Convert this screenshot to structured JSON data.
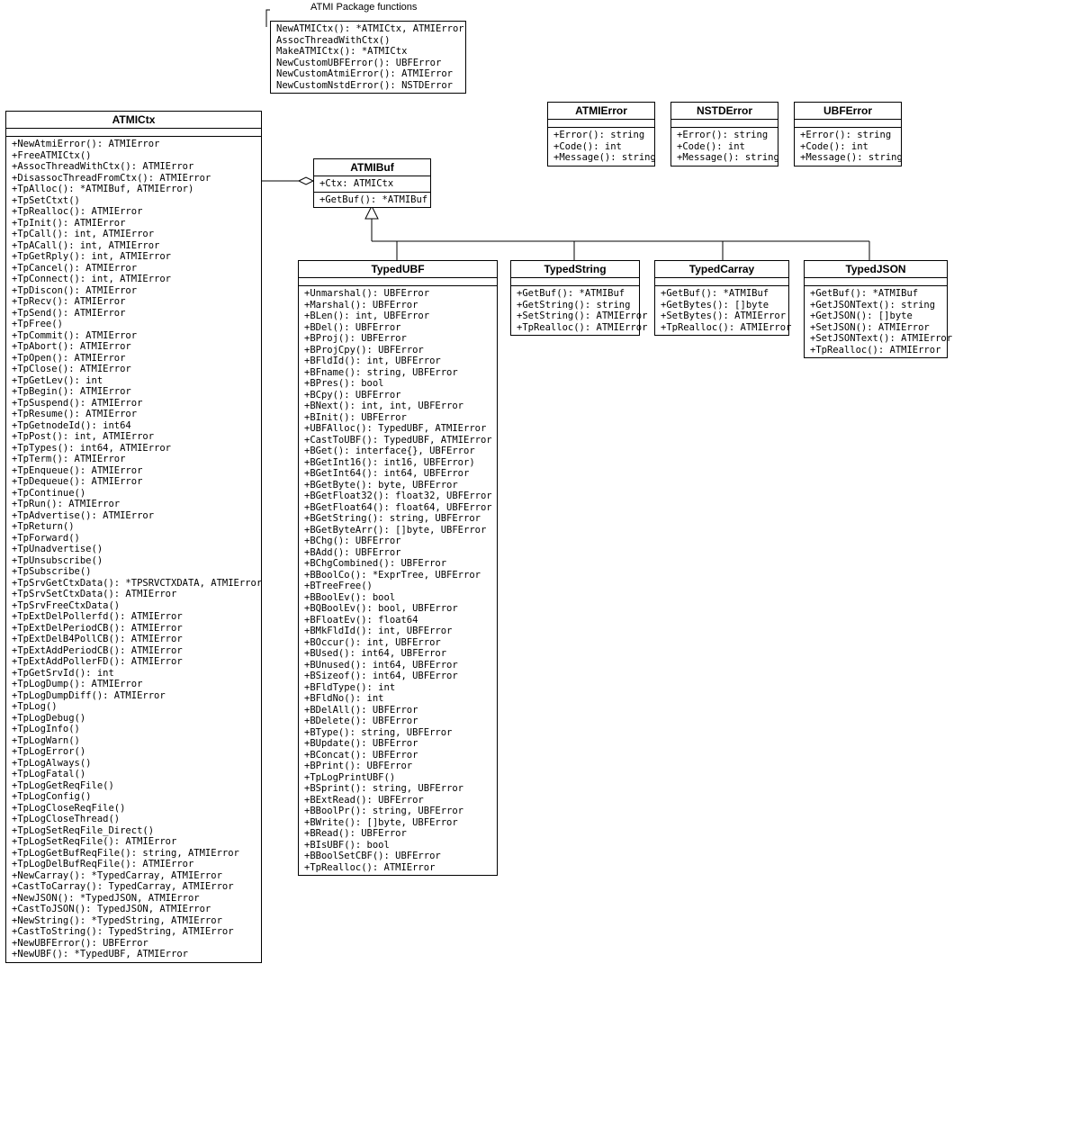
{
  "package_label": "ATMI Package functions",
  "package_box": {
    "methods": [
      "NewATMICtx(): *ATMICtx, ATMIError",
      "AssocThreadWithCtx()",
      "MakeATMICtx(): *ATMICtx",
      "NewCustomUBFError(): UBFError",
      "NewCustomAtmiError(): ATMIError",
      "NewCustomNstdError(): NSTDError"
    ]
  },
  "atmictx": {
    "title": "ATMICtx",
    "methods": [
      "+NewAtmiError(): ATMIError",
      "+FreeATMICtx()",
      "+AssocThreadWithCtx(): ATMIError",
      "+DisassocThreadFromCtx(): ATMIError",
      "+TpAlloc(): *ATMIBuf, ATMIError)",
      "+TpSetCtxt()",
      "+TpRealloc(): ATMIError",
      "+TpInit(): ATMIError",
      "+TpCall(): int, ATMIError",
      "+TpACall(): int, ATMIError",
      "+TpGetRply(): int, ATMIError",
      "+TpCancel(): ATMIError",
      "+TpConnect(): int, ATMIError",
      "+TpDiscon(): ATMIError",
      "+TpRecv(): ATMIError",
      "+TpSend(): ATMIError",
      "+TpFree()",
      "+TpCommit(): ATMIError",
      "+TpAbort(): ATMIError",
      "+TpOpen(): ATMIError",
      "+TpClose(): ATMIError",
      "+TpGetLev(): int",
      "+TpBegin(): ATMIError",
      "+TpSuspend(): ATMIError",
      "+TpResume(): ATMIError",
      "+TpGetnodeId(): int64",
      "+TpPost(): int, ATMIError",
      "+TpTypes(): int64, ATMIError",
      "+TpTerm(): ATMIError",
      "+TpEnqueue(): ATMIError",
      "+TpDequeue(): ATMIError",
      "+TpContinue()",
      "+TpRun(): ATMIError",
      "+TpAdvertise(): ATMIError",
      "+TpReturn()",
      "+TpForward()",
      "+TpUnadvertise()",
      "+TpUnsubscribe()",
      "+TpSubscribe()",
      "+TpSrvGetCtxData(): *TPSRVCTXDATA, ATMIError",
      "+TpSrvSetCtxData(): ATMIError",
      "+TpSrvFreeCtxData()",
      "+TpExtDelPollerfd(): ATMIError",
      "+TpExtDelPeriodCB(): ATMIError",
      "+TpExtDelB4PollCB(): ATMIError",
      "+TpExtAddPeriodCB(): ATMIError",
      "+TpExtAddPollerFD(): ATMIError",
      "+TpGetSrvId(): int",
      "+TpLogDump(): ATMIError",
      "+TpLogDumpDiff(): ATMIError",
      "+TpLog()",
      "+TpLogDebug()",
      "+TpLogInfo()",
      "+TpLogWarn()",
      "+TpLogError()",
      "+TpLogAlways()",
      "+TpLogFatal()",
      "+TpLogGetReqFile()",
      "+TpLogConfig()",
      "+TpLogCloseReqFile()",
      "+TpLogCloseThread()",
      "+TpLogSetReqFile_Direct()",
      "+TpLogSetReqFile(): ATMIError",
      "+TpLogGetBufReqFile(): string, ATMIError",
      "+TpLogDelBufReqFile(): ATMIError",
      "+NewCarray(): *TypedCarray, ATMIError",
      "+CastToCarray(): TypedCarray, ATMIError",
      "+NewJSON(): *TypedJSON, ATMIError",
      "+CastToJSON(): TypedJSON, ATMIError",
      "+NewString(): *TypedString, ATMIError",
      "+CastToString(): TypedString, ATMIError",
      "+NewUBFError(): UBFError",
      "+NewUBF(): *TypedUBF, ATMIError"
    ]
  },
  "atmibuf": {
    "title": "ATMIBuf",
    "members": [
      "+Ctx: ATMICtx",
      "+GetBuf(): *ATMIBuf"
    ]
  },
  "atmierror": {
    "title": "ATMIError",
    "methods": [
      "+Error(): string",
      "+Code(): int",
      "+Message(): string"
    ]
  },
  "nstderror": {
    "title": "NSTDError",
    "methods": [
      "+Error(): string",
      "+Code(): int",
      "+Message(): string"
    ]
  },
  "ubferror": {
    "title": "UBFError",
    "methods": [
      "+Error(): string",
      "+Code(): int",
      "+Message(): string"
    ]
  },
  "typedubf": {
    "title": "TypedUBF",
    "methods": [
      "+Unmarshal(): UBFError",
      "+Marshal(): UBFError",
      "+BLen(): int, UBFError",
      "+BDel(): UBFError",
      "+BProj(): UBFError",
      "+BProjCpy(): UBFError",
      "+BFldId(): int, UBFError",
      "+BFname(): string, UBFError",
      "+BPres(): bool",
      "+BCpy(): UBFError",
      "+BNext(): int, int, UBFError",
      "+BInit(): UBFError",
      "+UBFAlloc(): TypedUBF, ATMIError",
      "+CastToUBF(): TypedUBF, ATMIError",
      "+BGet(): interface{}, UBFError",
      "+BGetInt16(): int16, UBFError)",
      "+BGetInt64(): int64, UBFError",
      "+BGetByte(): byte, UBFError",
      "+BGetFloat32(): float32, UBFError",
      "+BGetFloat64(): float64, UBFError",
      "+BGetString(): string, UBFError",
      "+BGetByteArr(): []byte, UBFError",
      "+BChg(): UBFError",
      "+BAdd(): UBFError",
      "+BChgCombined(): UBFError",
      "+BBoolCo(): *ExprTree, UBFError",
      "+BTreeFree()",
      "+BBoolEv(): bool",
      "+BQBoolEv(): bool, UBFError",
      "+BFloatEv(): float64",
      "+BMkFldId(): int, UBFError",
      "+BOccur(): int, UBFError",
      "+BUsed(): int64, UBFError",
      "+BUnused(): int64, UBFError",
      "+BSizeof(): int64, UBFError",
      "+BFldType(): int",
      "+BFldNo(): int",
      "+BDelAll(): UBFError",
      "+BDelete(): UBFError",
      "+BType(): string, UBFError",
      "+BUpdate(): UBFError",
      "+BConcat(): UBFError",
      "+BPrint(): UBFError",
      "+TpLogPrintUBF()",
      "+BSprint(): string, UBFError",
      "+BExtRead(): UBFError",
      "+BBoolPr(): string, UBFError",
      "+BWrite(): []byte, UBFError",
      "+BRead(): UBFError",
      "+BIsUBF(): bool",
      "+BBoolSetCBF(): UBFError",
      "+TpRealloc(): ATMIError"
    ]
  },
  "typedstring": {
    "title": "TypedString",
    "methods": [
      "+GetBuf(): *ATMIBuf",
      "+GetString(): string",
      "+SetString(): ATMIError",
      "+TpRealloc(): ATMIError"
    ]
  },
  "typedcarray": {
    "title": "TypedCarray",
    "methods": [
      "+GetBuf(): *ATMIBuf",
      "+GetBytes(): []byte",
      "+SetBytes(): ATMIError",
      "+TpRealloc(): ATMIError"
    ]
  },
  "typedjson": {
    "title": "TypedJSON",
    "methods": [
      "+GetBuf(): *ATMIBuf",
      "+GetJSONText(): string",
      "+GetJSON(): []byte",
      "+SetJSON(): ATMIError",
      "+SetJSONText(): ATMIError",
      "+TpRealloc(): ATMIError"
    ]
  }
}
